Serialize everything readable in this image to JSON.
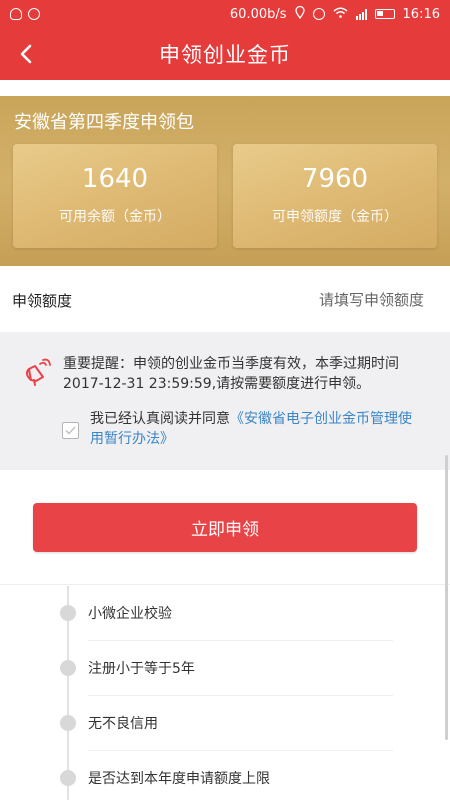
{
  "status_bar": {
    "network_speed": "60.00b/s",
    "time": "16:16",
    "icons": [
      "shield-heart-icon",
      "face-icon",
      "location-icon",
      "alarm-icon",
      "wifi-icon",
      "signal-icon",
      "battery-icon"
    ]
  },
  "nav": {
    "back_icon": "chevron-left-icon",
    "title": "申领创业金币"
  },
  "package": {
    "title": "安徽省第四季度申领包",
    "available_balance": {
      "value": "1640",
      "label": "可用余额（金币）"
    },
    "claimable_amount": {
      "value": "7960",
      "label": "可申领额度（金币）"
    }
  },
  "amount": {
    "label": "申领额度",
    "value": "",
    "placeholder": "请填写申领额度"
  },
  "notice": {
    "icon": "horn-icon",
    "text": "重要提醒：申领的创业金币当季度有效，本季过期时间2017-12-31 23:59:59,请按需要额度进行申领。",
    "agreement_prefix": "我已经认真阅读并同意",
    "agreement_link": "《安徽省电子创业金币管理使用暂行办法》",
    "agreed": true
  },
  "apply_button": "立即申领",
  "steps": [
    {
      "label": "小微企业校验"
    },
    {
      "label": "注册小于等于5年"
    },
    {
      "label": "无不良信用"
    },
    {
      "label": "是否达到本年度申请额度上限"
    }
  ],
  "colors": {
    "brand_red": "#e63b3b",
    "gold": "#d3b06a",
    "link_blue": "#3b86c6",
    "notice_bg": "#f0eff2"
  }
}
